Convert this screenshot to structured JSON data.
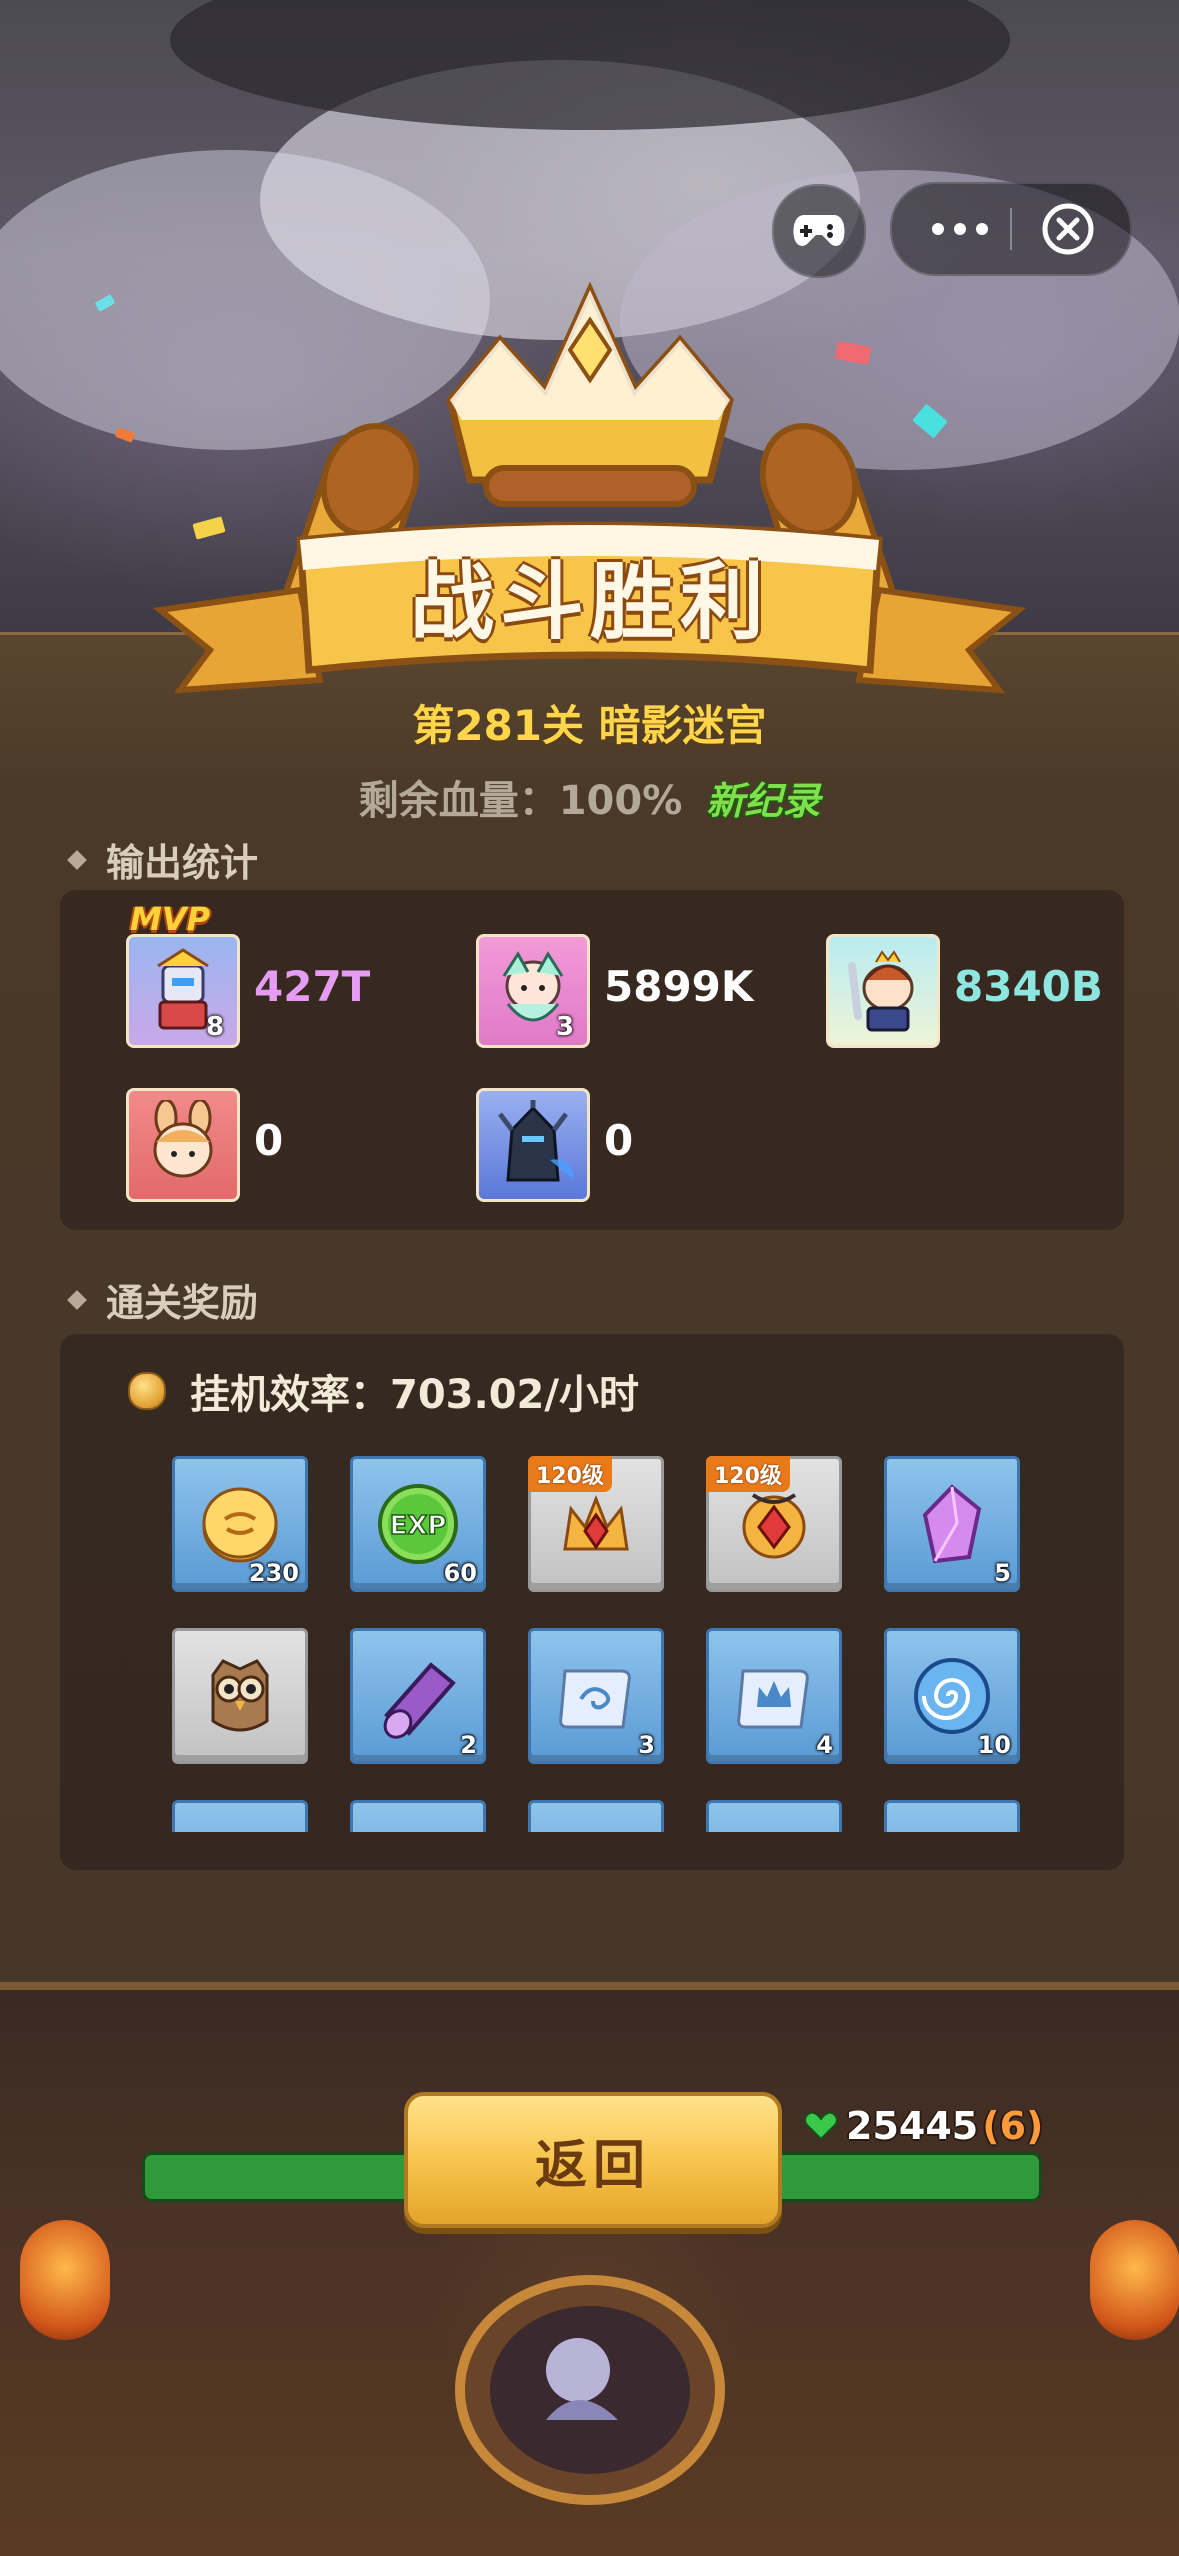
{
  "banner": {
    "title": "战斗胜利"
  },
  "stage": {
    "title": "第281关 暗影迷宫"
  },
  "hp": {
    "label": "剩余血量：100%",
    "new_record": "新纪录"
  },
  "damage_section": {
    "title": "输出统计",
    "mvp_label": "MVP",
    "heroes": [
      {
        "level": "8",
        "damage": "427T",
        "damage_color": "#e79cf3",
        "mvp": true
      },
      {
        "level": "3",
        "damage": "5899K",
        "damage_color": "#ffffff",
        "mvp": false
      },
      {
        "level": "",
        "damage": "8340B",
        "damage_color": "#8ee6e0",
        "mvp": false
      },
      {
        "level": "",
        "damage": "0",
        "damage_color": "#ffffff",
        "mvp": false
      },
      {
        "level": "",
        "damage": "0",
        "damage_color": "#ffffff",
        "mvp": false
      }
    ]
  },
  "rewards_section": {
    "title": "通关奖励",
    "efficiency": "挂机效率：703.02/小时",
    "items": [
      {
        "icon": "gold-coin-icon",
        "count": "230",
        "tag": ""
      },
      {
        "icon": "exp-orb-icon",
        "count": "60",
        "tag": ""
      },
      {
        "icon": "crown-gear-icon",
        "count": "",
        "tag": "120级"
      },
      {
        "icon": "amulet-gear-icon",
        "count": "",
        "tag": "120级"
      },
      {
        "icon": "purple-crystal-icon",
        "count": "5",
        "tag": ""
      },
      {
        "icon": "owl-icon",
        "count": "",
        "tag": ""
      },
      {
        "icon": "purple-log-icon",
        "count": "2",
        "tag": ""
      },
      {
        "icon": "scroll-wind-icon",
        "count": "3",
        "tag": ""
      },
      {
        "icon": "scroll-crown-icon",
        "count": "4",
        "tag": ""
      },
      {
        "icon": "blue-swirl-icon",
        "count": "10",
        "tag": ""
      }
    ]
  },
  "bottom": {
    "back_label": "返回",
    "hp_value": "25445",
    "hp_sub": "(6)"
  },
  "colors": {
    "accent_gold": "#ffd54a",
    "new_record_green": "#7ee04a",
    "panel_brown": "#46372a"
  }
}
